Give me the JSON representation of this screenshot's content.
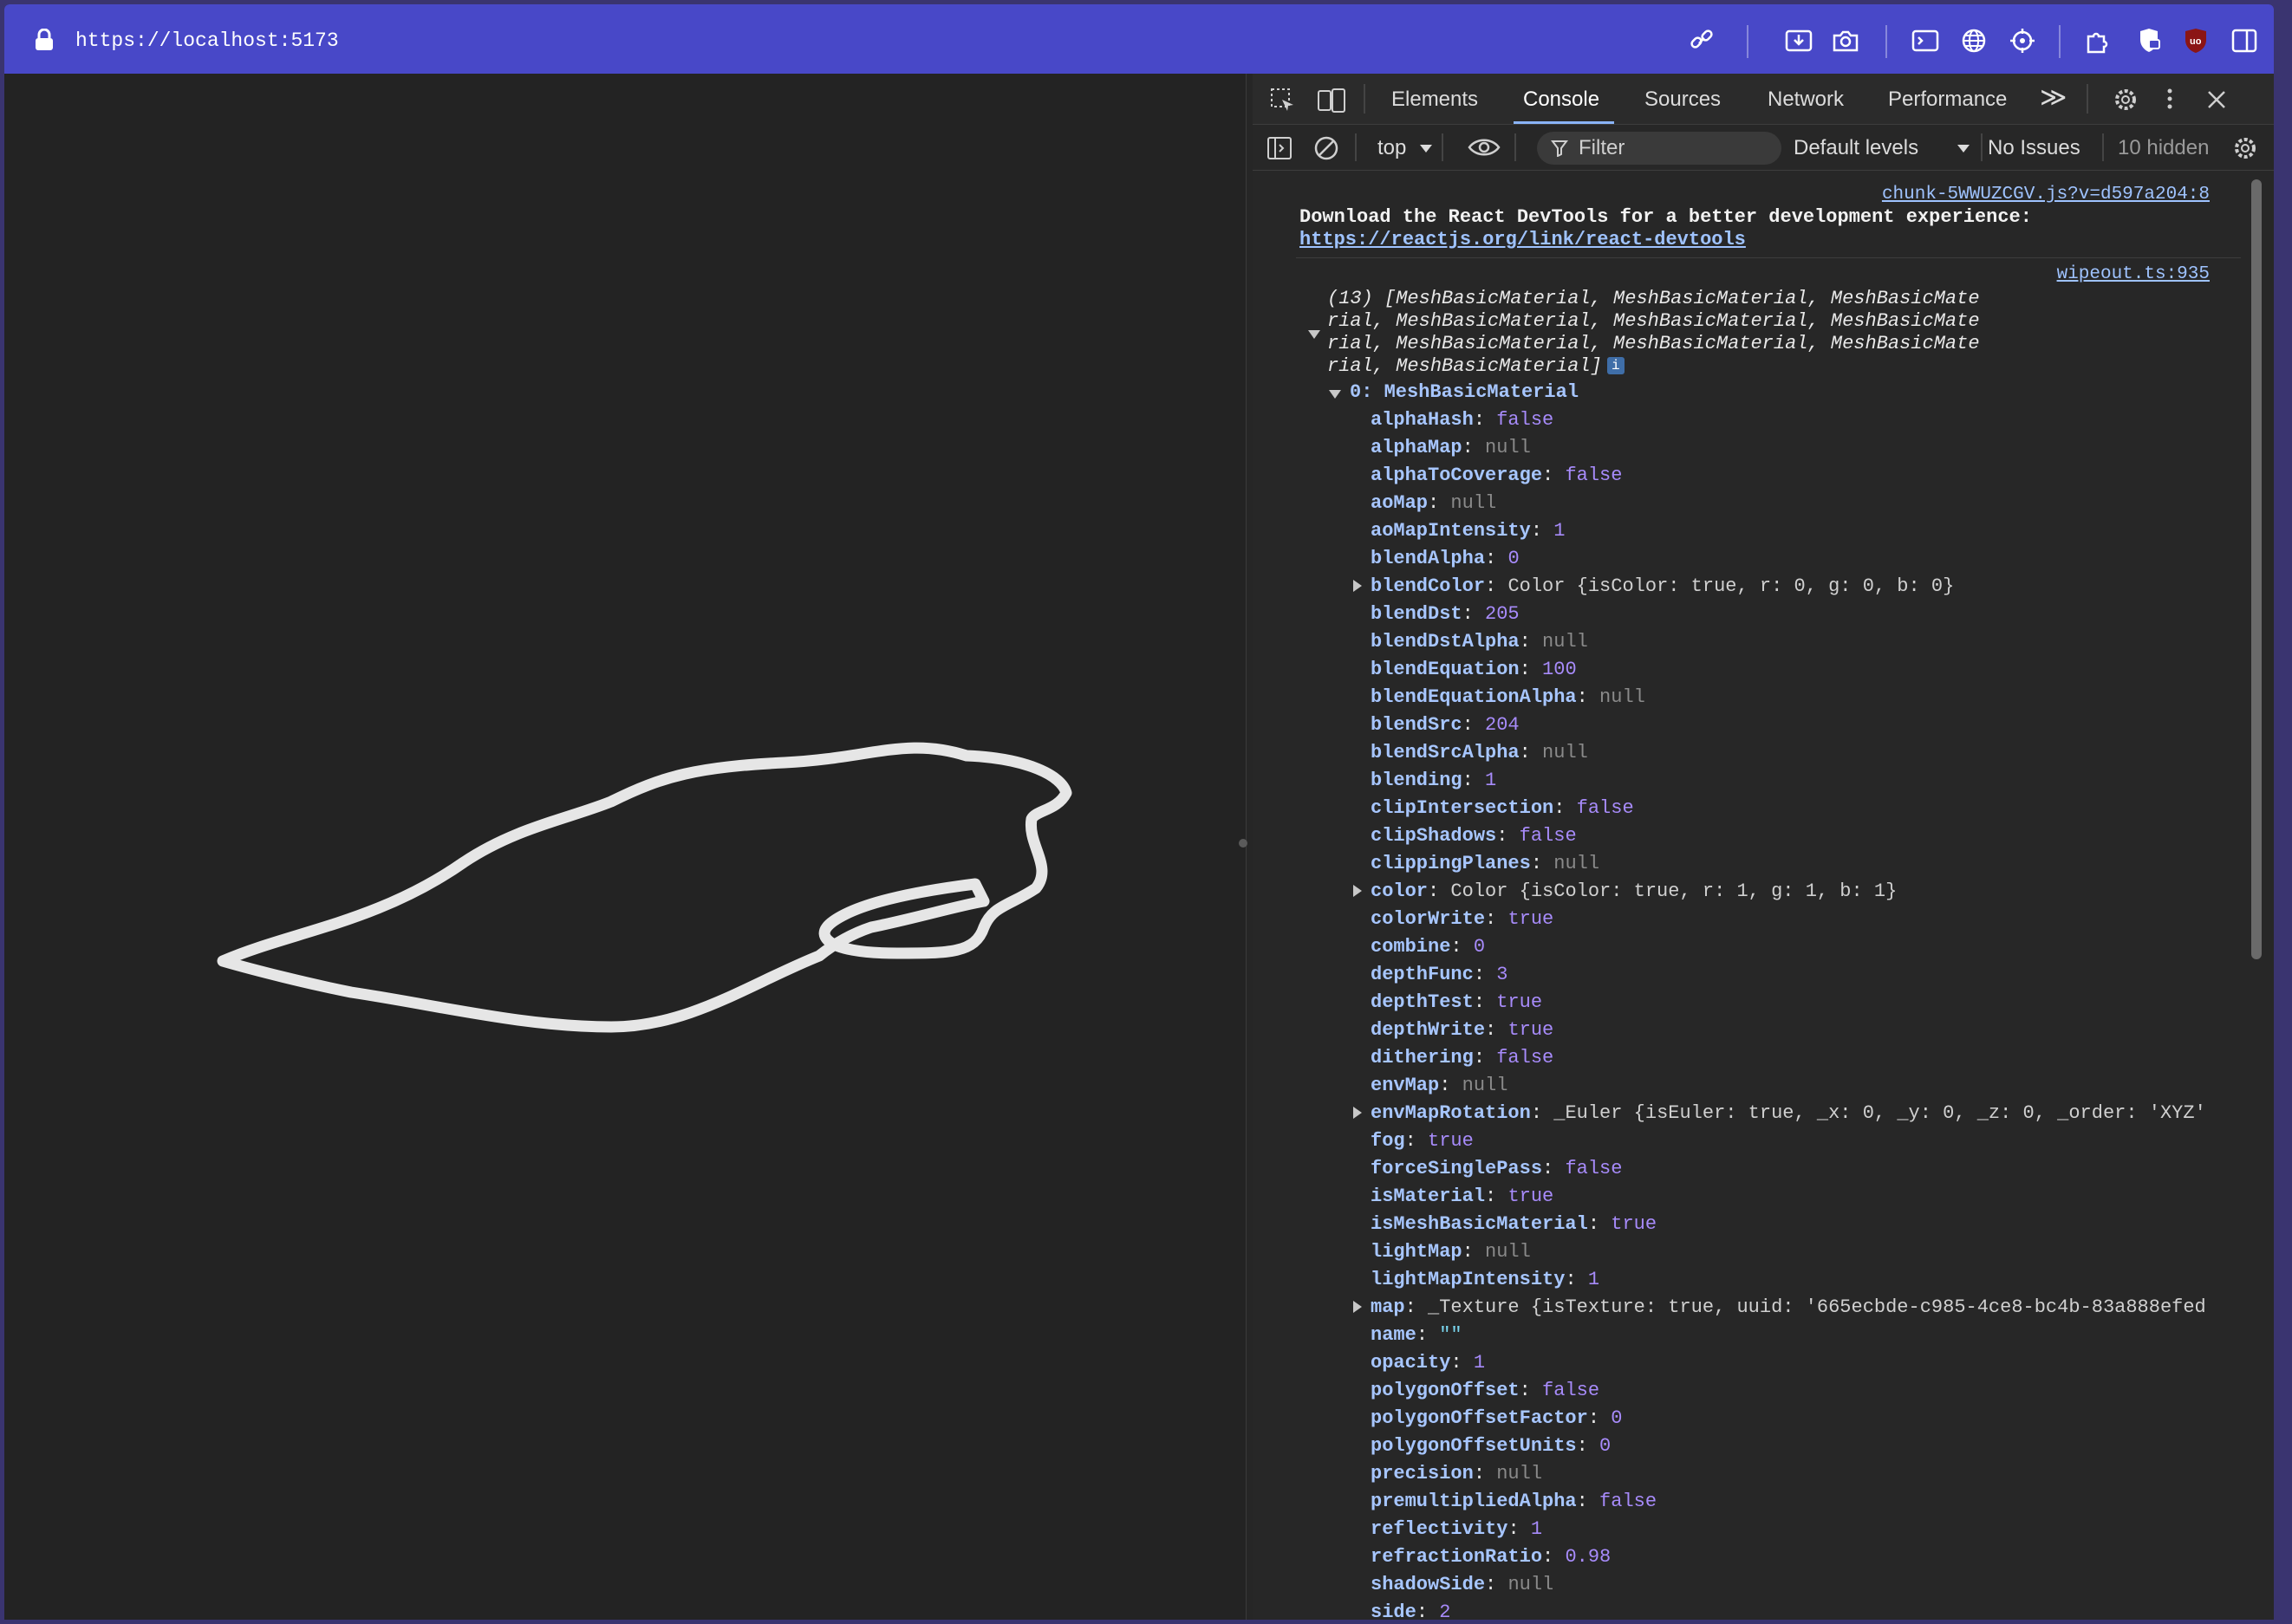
{
  "browser": {
    "url": "https://localhost:5173"
  },
  "devtools": {
    "tabs": [
      "Elements",
      "Console",
      "Sources",
      "Network",
      "Performance"
    ],
    "active_tab": "Console",
    "overflow_glyph": "≫",
    "toolbar": {
      "context": "top",
      "filter_placeholder": "Filter",
      "levels": "Default levels",
      "issues": "No Issues",
      "hidden": "10 hidden"
    }
  },
  "console": {
    "msg1": {
      "source": "chunk-5WWUZCGV.js?v=d597a204:8",
      "text": "Download the React DevTools for a better development experience:",
      "link": "https://reactjs.org/link/react-devtools"
    },
    "msg2": {
      "source": "wipeout.ts:935",
      "array_lines": [
        "(13) [MeshBasicMaterial, MeshBasicMaterial, MeshBasicMate",
        "rial, MeshBasicMaterial, MeshBasicMaterial, MeshBasicMate",
        "rial, MeshBasicMaterial, MeshBasicMaterial, MeshBasicMate",
        "rial, MeshBasicMaterial]"
      ],
      "info_badge": "i",
      "item_header": "0: MeshBasicMaterial",
      "properties": [
        {
          "key": "alphaHash",
          "value": "false",
          "kind": "bool"
        },
        {
          "key": "alphaMap",
          "value": "null",
          "kind": "null"
        },
        {
          "key": "alphaToCoverage",
          "value": "false",
          "kind": "bool"
        },
        {
          "key": "aoMap",
          "value": "null",
          "kind": "null"
        },
        {
          "key": "aoMapIntensity",
          "value": "1",
          "kind": "num"
        },
        {
          "key": "blendAlpha",
          "value": "0",
          "kind": "num"
        },
        {
          "key": "blendColor",
          "value": "Color {isColor: true, r: 0, g: 0, b: 0}",
          "kind": "obj",
          "expandable": true
        },
        {
          "key": "blendDst",
          "value": "205",
          "kind": "num"
        },
        {
          "key": "blendDstAlpha",
          "value": "null",
          "kind": "null"
        },
        {
          "key": "blendEquation",
          "value": "100",
          "kind": "num"
        },
        {
          "key": "blendEquationAlpha",
          "value": "null",
          "kind": "null"
        },
        {
          "key": "blendSrc",
          "value": "204",
          "kind": "num"
        },
        {
          "key": "blendSrcAlpha",
          "value": "null",
          "kind": "null"
        },
        {
          "key": "blending",
          "value": "1",
          "kind": "num"
        },
        {
          "key": "clipIntersection",
          "value": "false",
          "kind": "bool"
        },
        {
          "key": "clipShadows",
          "value": "false",
          "kind": "bool"
        },
        {
          "key": "clippingPlanes",
          "value": "null",
          "kind": "null"
        },
        {
          "key": "color",
          "value": "Color {isColor: true, r: 1, g: 1, b: 1}",
          "kind": "obj",
          "expandable": true
        },
        {
          "key": "colorWrite",
          "value": "true",
          "kind": "bool"
        },
        {
          "key": "combine",
          "value": "0",
          "kind": "num"
        },
        {
          "key": "depthFunc",
          "value": "3",
          "kind": "num"
        },
        {
          "key": "depthTest",
          "value": "true",
          "kind": "bool"
        },
        {
          "key": "depthWrite",
          "value": "true",
          "kind": "bool"
        },
        {
          "key": "dithering",
          "value": "false",
          "kind": "bool"
        },
        {
          "key": "envMap",
          "value": "null",
          "kind": "null"
        },
        {
          "key": "envMapRotation",
          "value": "_Euler {isEuler: true, _x: 0, _y: 0, _z: 0, _order: 'XYZ'",
          "kind": "obj",
          "expandable": true
        },
        {
          "key": "fog",
          "value": "true",
          "kind": "bool"
        },
        {
          "key": "forceSinglePass",
          "value": "false",
          "kind": "bool"
        },
        {
          "key": "isMaterial",
          "value": "true",
          "kind": "bool"
        },
        {
          "key": "isMeshBasicMaterial",
          "value": "true",
          "kind": "bool"
        },
        {
          "key": "lightMap",
          "value": "null",
          "kind": "null"
        },
        {
          "key": "lightMapIntensity",
          "value": "1",
          "kind": "num"
        },
        {
          "key": "map",
          "value": "_Texture {isTexture: true, uuid: '665ecbde-c985-4ce8-bc4b-83a888efed",
          "kind": "obj",
          "expandable": true
        },
        {
          "key": "name",
          "value": "\"\"",
          "kind": "str"
        },
        {
          "key": "opacity",
          "value": "1",
          "kind": "num"
        },
        {
          "key": "polygonOffset",
          "value": "false",
          "kind": "bool"
        },
        {
          "key": "polygonOffsetFactor",
          "value": "0",
          "kind": "num"
        },
        {
          "key": "polygonOffsetUnits",
          "value": "0",
          "kind": "num"
        },
        {
          "key": "precision",
          "value": "null",
          "kind": "null"
        },
        {
          "key": "premultipliedAlpha",
          "value": "false",
          "kind": "bool"
        },
        {
          "key": "reflectivity",
          "value": "1",
          "kind": "num"
        },
        {
          "key": "refractionRatio",
          "value": "0.98",
          "kind": "num"
        },
        {
          "key": "shadowSide",
          "value": "null",
          "kind": "null"
        },
        {
          "key": "side",
          "value": "2",
          "kind": "num"
        }
      ]
    }
  },
  "colors": {
    "address_bar": "#4848c8",
    "viewport_bg": "#232323",
    "track_stroke": "#e6e6e6",
    "link": "#9fc3ff",
    "property_key": "#a7c6ff",
    "bool_num": "#a78bfa",
    "null": "#8a8a8a"
  }
}
